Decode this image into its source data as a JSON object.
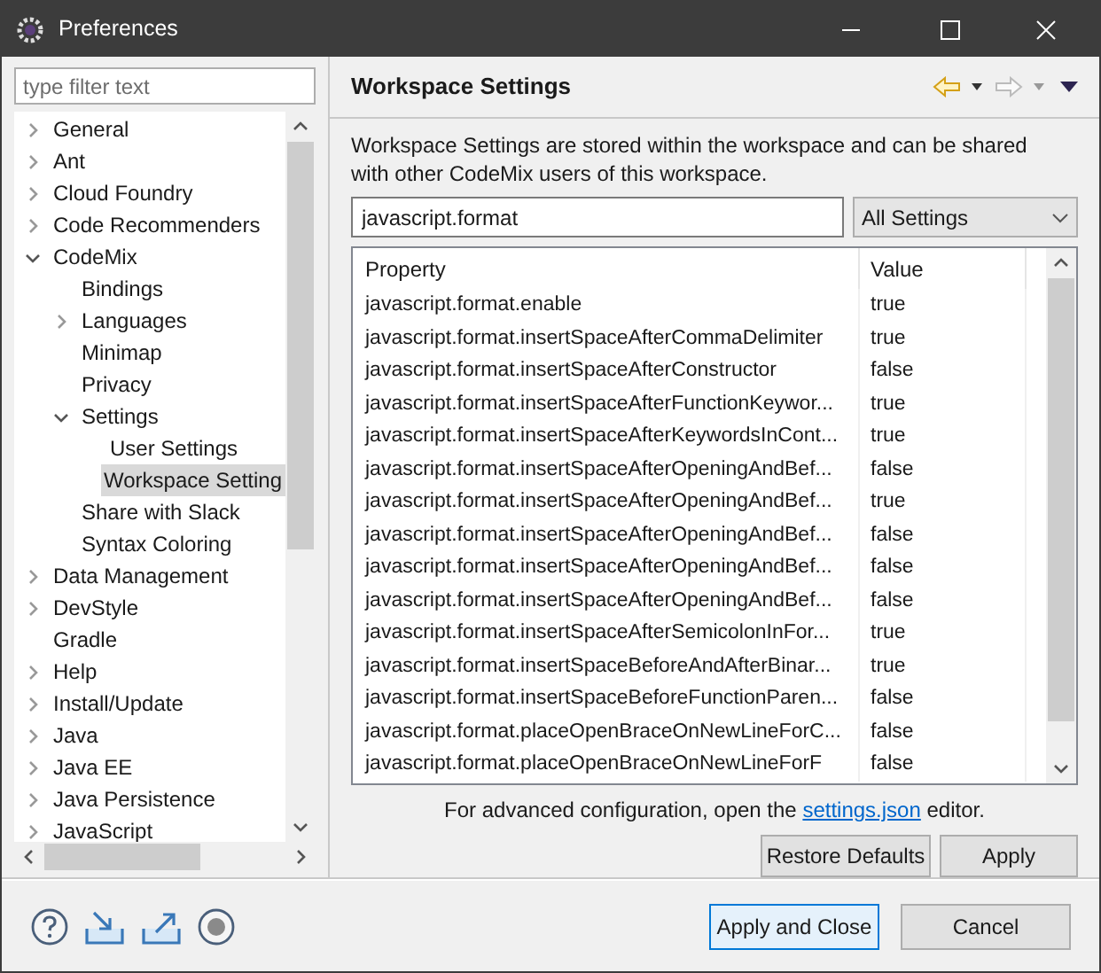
{
  "window": {
    "title": "Preferences"
  },
  "filter": {
    "placeholder": "type filter text"
  },
  "tree": [
    {
      "label": "General",
      "expanded": false,
      "selected": false
    },
    {
      "label": "Ant",
      "expanded": false,
      "selected": false
    },
    {
      "label": "Cloud Foundry",
      "expanded": false,
      "selected": false
    },
    {
      "label": "Code Recommenders",
      "expanded": false,
      "selected": false
    },
    {
      "label": "CodeMix",
      "expanded": true,
      "selected": false,
      "children": [
        {
          "label": "Bindings",
          "selected": false
        },
        {
          "label": "Languages",
          "expanded": false,
          "selected": false
        },
        {
          "label": "Minimap",
          "selected": false
        },
        {
          "label": "Privacy",
          "selected": false
        },
        {
          "label": "Settings",
          "expanded": true,
          "selected": false,
          "children": [
            {
              "label": "User Settings",
              "selected": false
            },
            {
              "label": "Workspace Setting",
              "selected": true
            }
          ]
        },
        {
          "label": "Share with Slack",
          "selected": false
        },
        {
          "label": "Syntax Coloring",
          "selected": false
        }
      ]
    },
    {
      "label": "Data Management",
      "expanded": false,
      "selected": false
    },
    {
      "label": "DevStyle",
      "expanded": false,
      "selected": false
    },
    {
      "label": "Gradle",
      "selected": false
    },
    {
      "label": "Help",
      "expanded": false,
      "selected": false
    },
    {
      "label": "Install/Update",
      "expanded": false,
      "selected": false
    },
    {
      "label": "Java",
      "expanded": false,
      "selected": false
    },
    {
      "label": "Java EE",
      "expanded": false,
      "selected": false
    },
    {
      "label": "Java Persistence",
      "expanded": false,
      "selected": false
    },
    {
      "label": "JavaScript",
      "expanded": false,
      "selected": false
    }
  ],
  "page": {
    "title": "Workspace Settings",
    "description": "Workspace Settings are stored within the workspace and can be shared with other CodeMix users of this workspace.",
    "search": {
      "value": "javascript.format"
    },
    "scope": {
      "value": "All Settings"
    },
    "table": {
      "columns": [
        "Property",
        "Value"
      ],
      "rows": [
        [
          "javascript.format.enable",
          "true"
        ],
        [
          "javascript.format.insertSpaceAfterCommaDelimiter",
          "true"
        ],
        [
          "javascript.format.insertSpaceAfterConstructor",
          "false"
        ],
        [
          "javascript.format.insertSpaceAfterFunctionKeywor...",
          "true"
        ],
        [
          "javascript.format.insertSpaceAfterKeywordsInCont...",
          "true"
        ],
        [
          "javascript.format.insertSpaceAfterOpeningAndBef...",
          "false"
        ],
        [
          "javascript.format.insertSpaceAfterOpeningAndBef...",
          "true"
        ],
        [
          "javascript.format.insertSpaceAfterOpeningAndBef...",
          "false"
        ],
        [
          "javascript.format.insertSpaceAfterOpeningAndBef...",
          "false"
        ],
        [
          "javascript.format.insertSpaceAfterOpeningAndBef...",
          "false"
        ],
        [
          "javascript.format.insertSpaceAfterSemicolonInFor...",
          "true"
        ],
        [
          "javascript.format.insertSpaceBeforeAndAfterBinar...",
          "true"
        ],
        [
          "javascript.format.insertSpaceBeforeFunctionParen...",
          "false"
        ],
        [
          "javascript.format.placeOpenBraceOnNewLineForC...",
          "false"
        ],
        [
          "javascript.format.placeOpenBraceOnNewLineForF",
          "false"
        ]
      ]
    },
    "note": {
      "before": "For advanced configuration, open the",
      "link": "settings.json",
      "after": "editor."
    },
    "buttons": [
      "Restore Defaults",
      "Apply"
    ]
  },
  "footer": {
    "buttons": [
      {
        "label": "Apply and Close",
        "default": true
      },
      {
        "label": "Cancel",
        "default": false
      }
    ]
  }
}
